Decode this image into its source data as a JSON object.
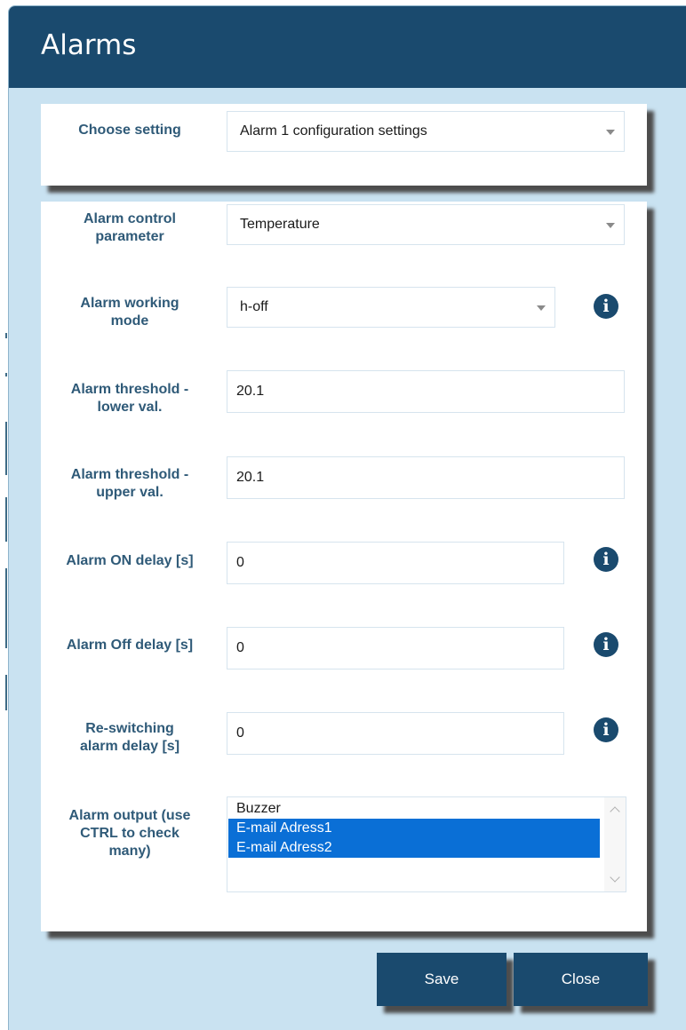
{
  "dialog": {
    "title": "Alarms"
  },
  "choose_setting": {
    "label": "Choose setting",
    "value": "Alarm 1 configuration settings"
  },
  "fields": {
    "control_parameter": {
      "label_line1": "Alarm control",
      "label_line2": "parameter",
      "value": "Temperature"
    },
    "working_mode": {
      "label_line1": "Alarm working",
      "label_line2": "mode",
      "value": "h-off"
    },
    "threshold_lower": {
      "label_line1": "Alarm threshold -",
      "label_line2": "lower val.",
      "value": "20.1"
    },
    "threshold_upper": {
      "label_line1": "Alarm threshold -",
      "label_line2": "upper val.",
      "value": "20.1"
    },
    "on_delay": {
      "label": "Alarm ON delay [s]",
      "value": "0"
    },
    "off_delay": {
      "label": "Alarm Off delay [s]",
      "value": "0"
    },
    "reswitching_delay": {
      "label_line1": "Re-switching",
      "label_line2": "alarm delay [s]",
      "value": "0"
    },
    "alarm_output": {
      "label_line1": "Alarm output (use",
      "label_line2": "CTRL to check",
      "label_line3": "many)",
      "options": [
        {
          "label": "Buzzer",
          "selected": false
        },
        {
          "label": "E-mail Adress1",
          "selected": true
        },
        {
          "label": "E-mail Adress2",
          "selected": true
        }
      ]
    }
  },
  "buttons": {
    "save": "Save",
    "close": "Close"
  },
  "icons": {
    "info": "i",
    "dropdown": "chevron-down-icon"
  },
  "colors": {
    "header": "#1a4a6e",
    "background": "#c9e2f1",
    "label": "#2f5a78",
    "selection": "#0a6fd6"
  }
}
